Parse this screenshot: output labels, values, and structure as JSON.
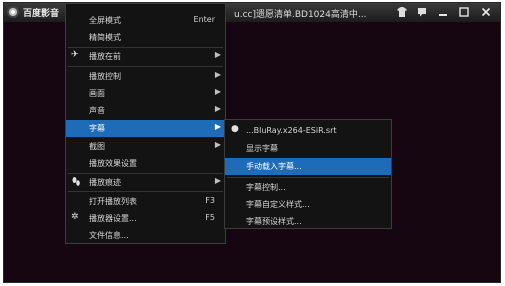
{
  "titlebar": {
    "app_name": "百度影音",
    "window_title": "u.cc]遗愿清单.BD1024高清中...",
    "buttons": [
      "shirt-icon",
      "chat-icon",
      "minimize-icon",
      "maximize-icon",
      "close-icon"
    ]
  },
  "main_menu": {
    "items": [
      {
        "label": "全屏模式",
        "shortcut": "Enter"
      },
      {
        "label": "精简模式"
      },
      {
        "label": "播放在前",
        "icon": "pin-icon",
        "submenu": true
      },
      {
        "label": "播放控制",
        "submenu": true
      },
      {
        "label": "画面",
        "submenu": true
      },
      {
        "label": "声音",
        "submenu": true
      },
      {
        "label": "字幕",
        "submenu": true,
        "highlighted": true
      },
      {
        "label": "截图",
        "submenu": true
      },
      {
        "label": "播放效果设置"
      },
      {
        "label": "播放痕迹",
        "icon": "footprint-icon",
        "submenu": true
      },
      {
        "label": "打开播放列表",
        "shortcut": "F3"
      },
      {
        "label": "播放器设置...",
        "icon": "gear-icon",
        "shortcut": "F5"
      },
      {
        "label": "文件信息..."
      }
    ]
  },
  "subtitle_menu": {
    "items": [
      {
        "label": "...BluRay.x264-ESiR.srt",
        "checked": true
      },
      {
        "label": "显示字幕"
      },
      {
        "label": "手动载入字幕...",
        "highlighted": true
      },
      {
        "label": "字幕控制..."
      },
      {
        "label": "字幕自定义样式..."
      },
      {
        "label": "字幕预设样式..."
      }
    ]
  },
  "colors": {
    "highlight": "#1e6bb8",
    "menu_bg": "#131313",
    "video_bg": "#150612"
  }
}
